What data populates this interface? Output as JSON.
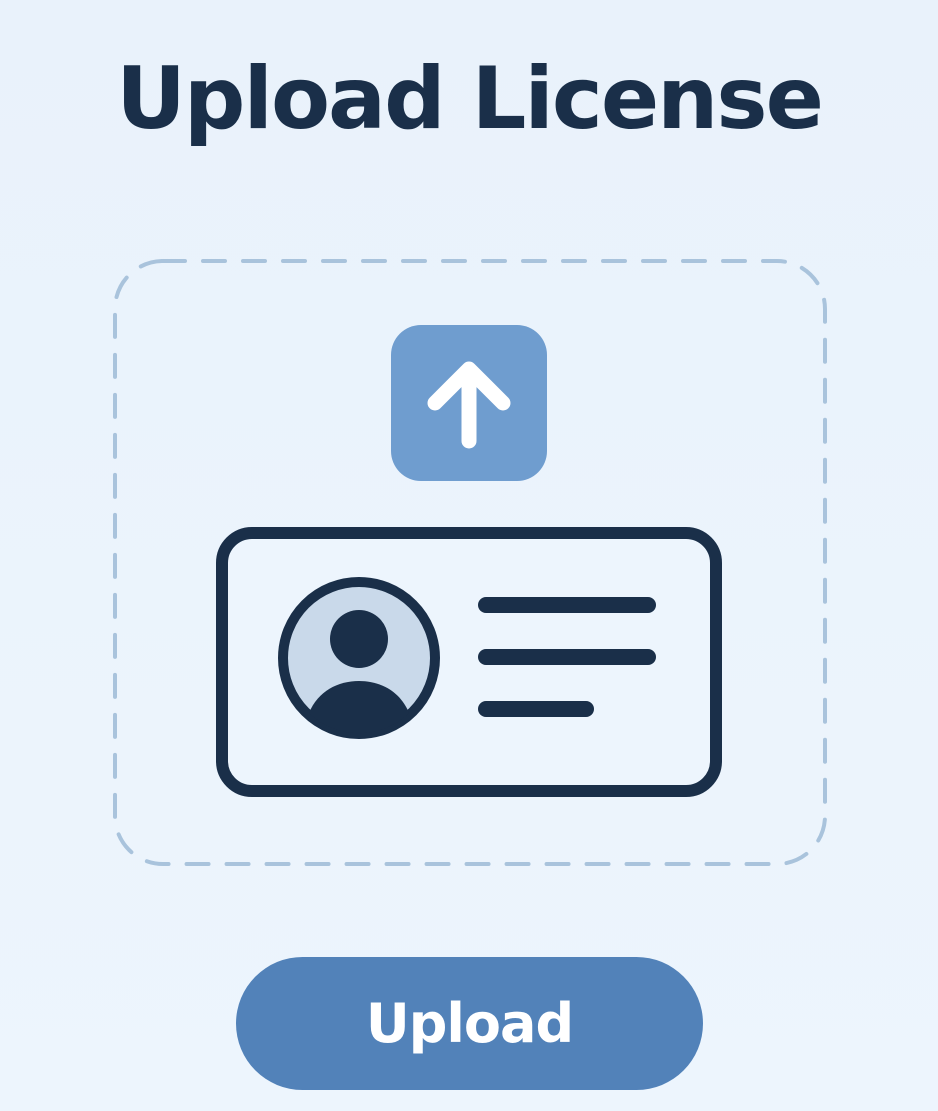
{
  "title": "Upload License",
  "dropzone": {
    "upload_icon": "arrow-up-icon",
    "card_icon": "id-card-icon"
  },
  "upload_button": {
    "label": "Upload"
  },
  "colors": {
    "background": "#eaf3fc",
    "title": "#1a2f49",
    "dashed_border": "#a9c3dc",
    "icon_tile": "#6f9dcf",
    "card_stroke": "#1a2f49",
    "avatar_fill": "#c9d9ea",
    "button": "#5282b9",
    "button_text": "#ffffff"
  }
}
